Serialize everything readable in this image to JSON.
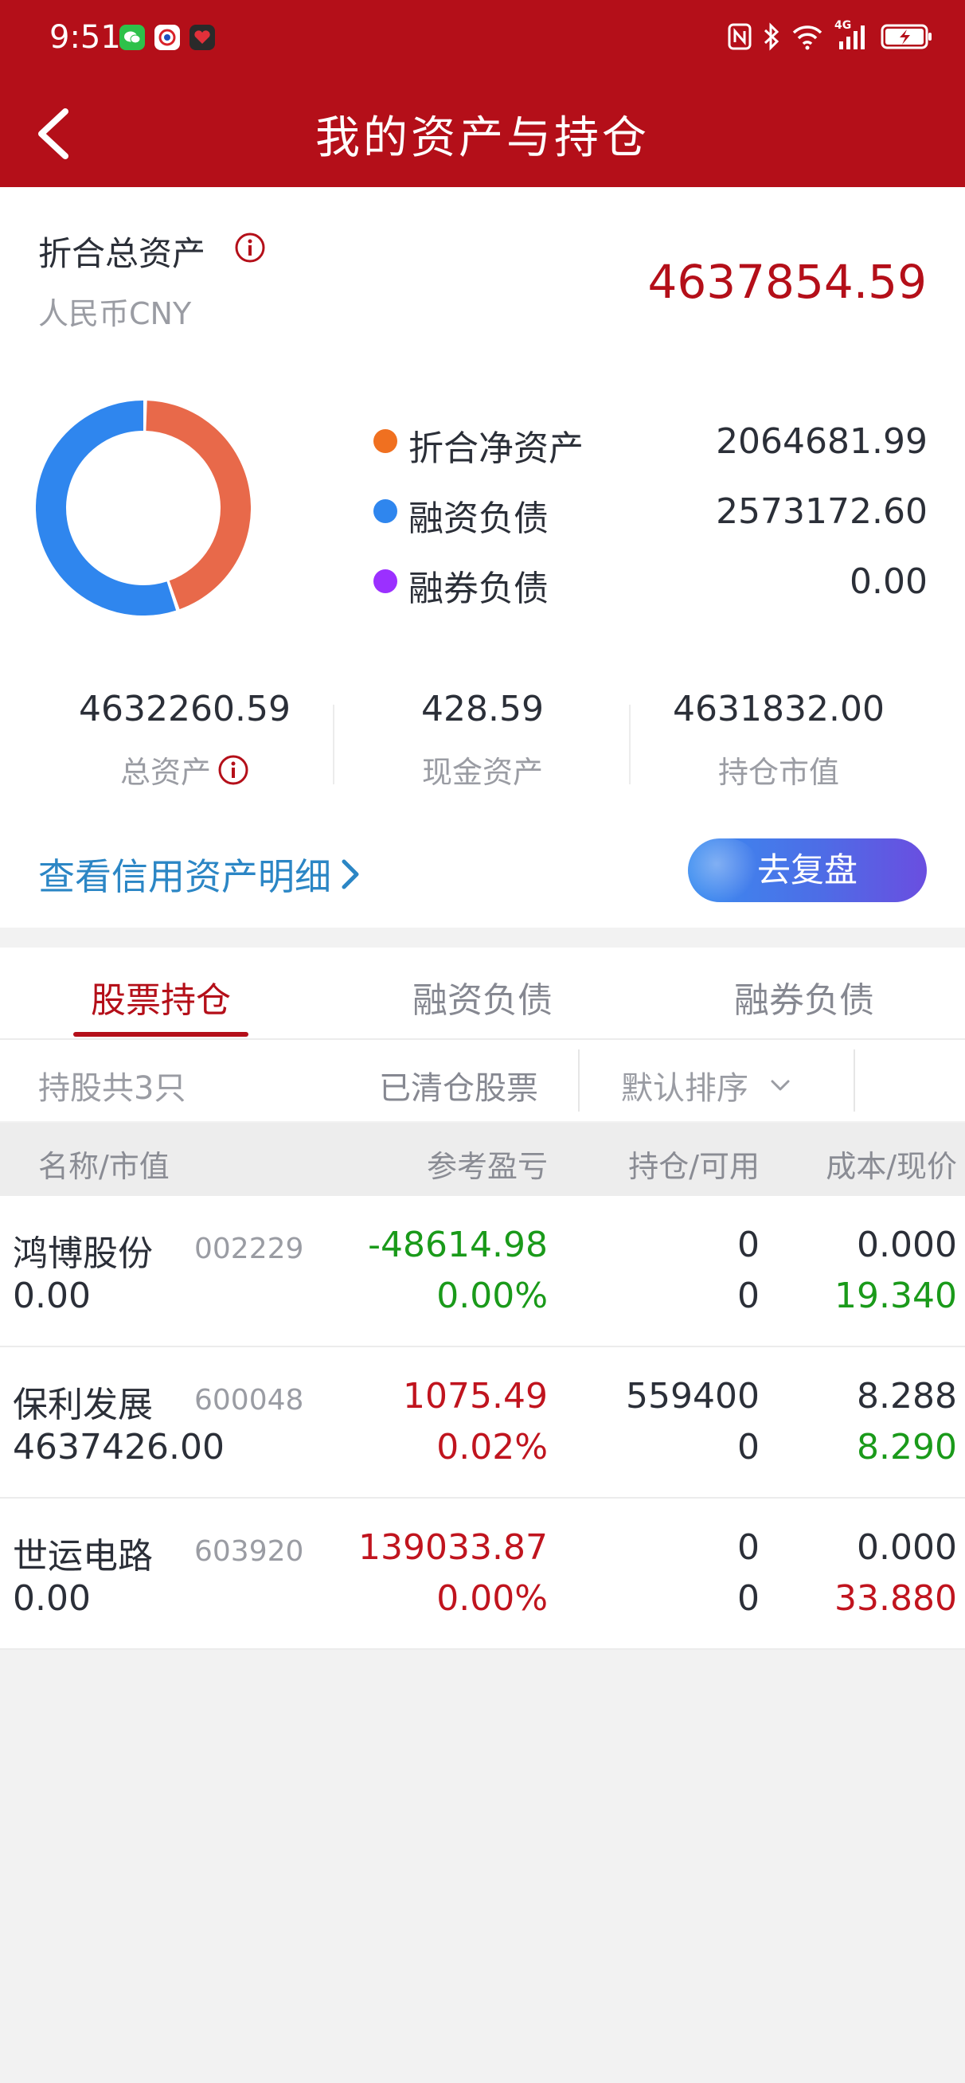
{
  "status_bar": {
    "time": "9:51",
    "app_icons": [
      "wechat-icon",
      "browser-icon",
      "health-app-icon"
    ],
    "right_icons": [
      "nfc-icon",
      "bluetooth-icon",
      "wifi-icon",
      "signal-4g-icon",
      "battery-charging-icon"
    ],
    "network_label": "4G"
  },
  "header": {
    "title": "我的资产与持仓",
    "back_icon": "chevron-left-icon"
  },
  "summary": {
    "total_label": "折合总资产",
    "currency": "人民币CNY",
    "total_value": "4637854.59",
    "legend": [
      {
        "name": "折合净资产",
        "value": "2064681.99",
        "color": "#f07020"
      },
      {
        "name": "融资负债",
        "value": "2573172.60",
        "color": "#2f86ee"
      },
      {
        "name": "融券负债",
        "value": "0.00",
        "color": "#9b30ff"
      }
    ],
    "stats": [
      {
        "value": "4632260.59",
        "label": "总资产"
      },
      {
        "value": "428.59",
        "label": "现金资产"
      },
      {
        "value": "4631832.00",
        "label": "持仓市值"
      }
    ],
    "detail_link": "查看信用资产明细",
    "review_button": "去复盘"
  },
  "donut": {
    "segments": [
      {
        "value": 2064681.99,
        "color": "#e8694a"
      },
      {
        "value": 2573172.6,
        "color": "#2f86ee"
      },
      {
        "value": 0.0,
        "color": "#9b30ff"
      }
    ]
  },
  "tabs": {
    "items": [
      "股票持仓",
      "融资负债",
      "融券负债"
    ],
    "active_index": 0
  },
  "filter": {
    "count": "持股共3只",
    "cleared": "已清仓股票",
    "sort": "默认排序"
  },
  "table": {
    "headers": [
      "名称/市值",
      "参考盈亏",
      "持仓/可用",
      "成本/现价"
    ],
    "rows": [
      {
        "name": "鸿博股份",
        "code": "002229",
        "market_value": "0.00",
        "pl": "-48614.98",
        "pl_pct": "0.00%",
        "position": "0",
        "available": "0",
        "cost": "0.000",
        "price": "19.340",
        "pl_color": "#1a9a1a",
        "price_color": "#1a9a1a"
      },
      {
        "name": "保利发展",
        "code": "600048",
        "market_value": "4637426.00",
        "pl": "1075.49",
        "pl_pct": "0.02%",
        "position": "559400",
        "available": "0",
        "cost": "8.288",
        "price": "8.290",
        "pl_color": "#c0141e",
        "price_color": "#1a9a1a"
      },
      {
        "name": "世运电路",
        "code": "603920",
        "market_value": "0.00",
        "pl": "139033.87",
        "pl_pct": "0.00%",
        "position": "0",
        "available": "0",
        "cost": "0.000",
        "price": "33.880",
        "pl_color": "#c0141e",
        "price_color": "#c0141e"
      }
    ]
  },
  "colors": {
    "brand_red": "#b40f19",
    "link_blue": "#2b86c5",
    "gain_red": "#c0141e",
    "loss_green": "#1a9a1a"
  }
}
